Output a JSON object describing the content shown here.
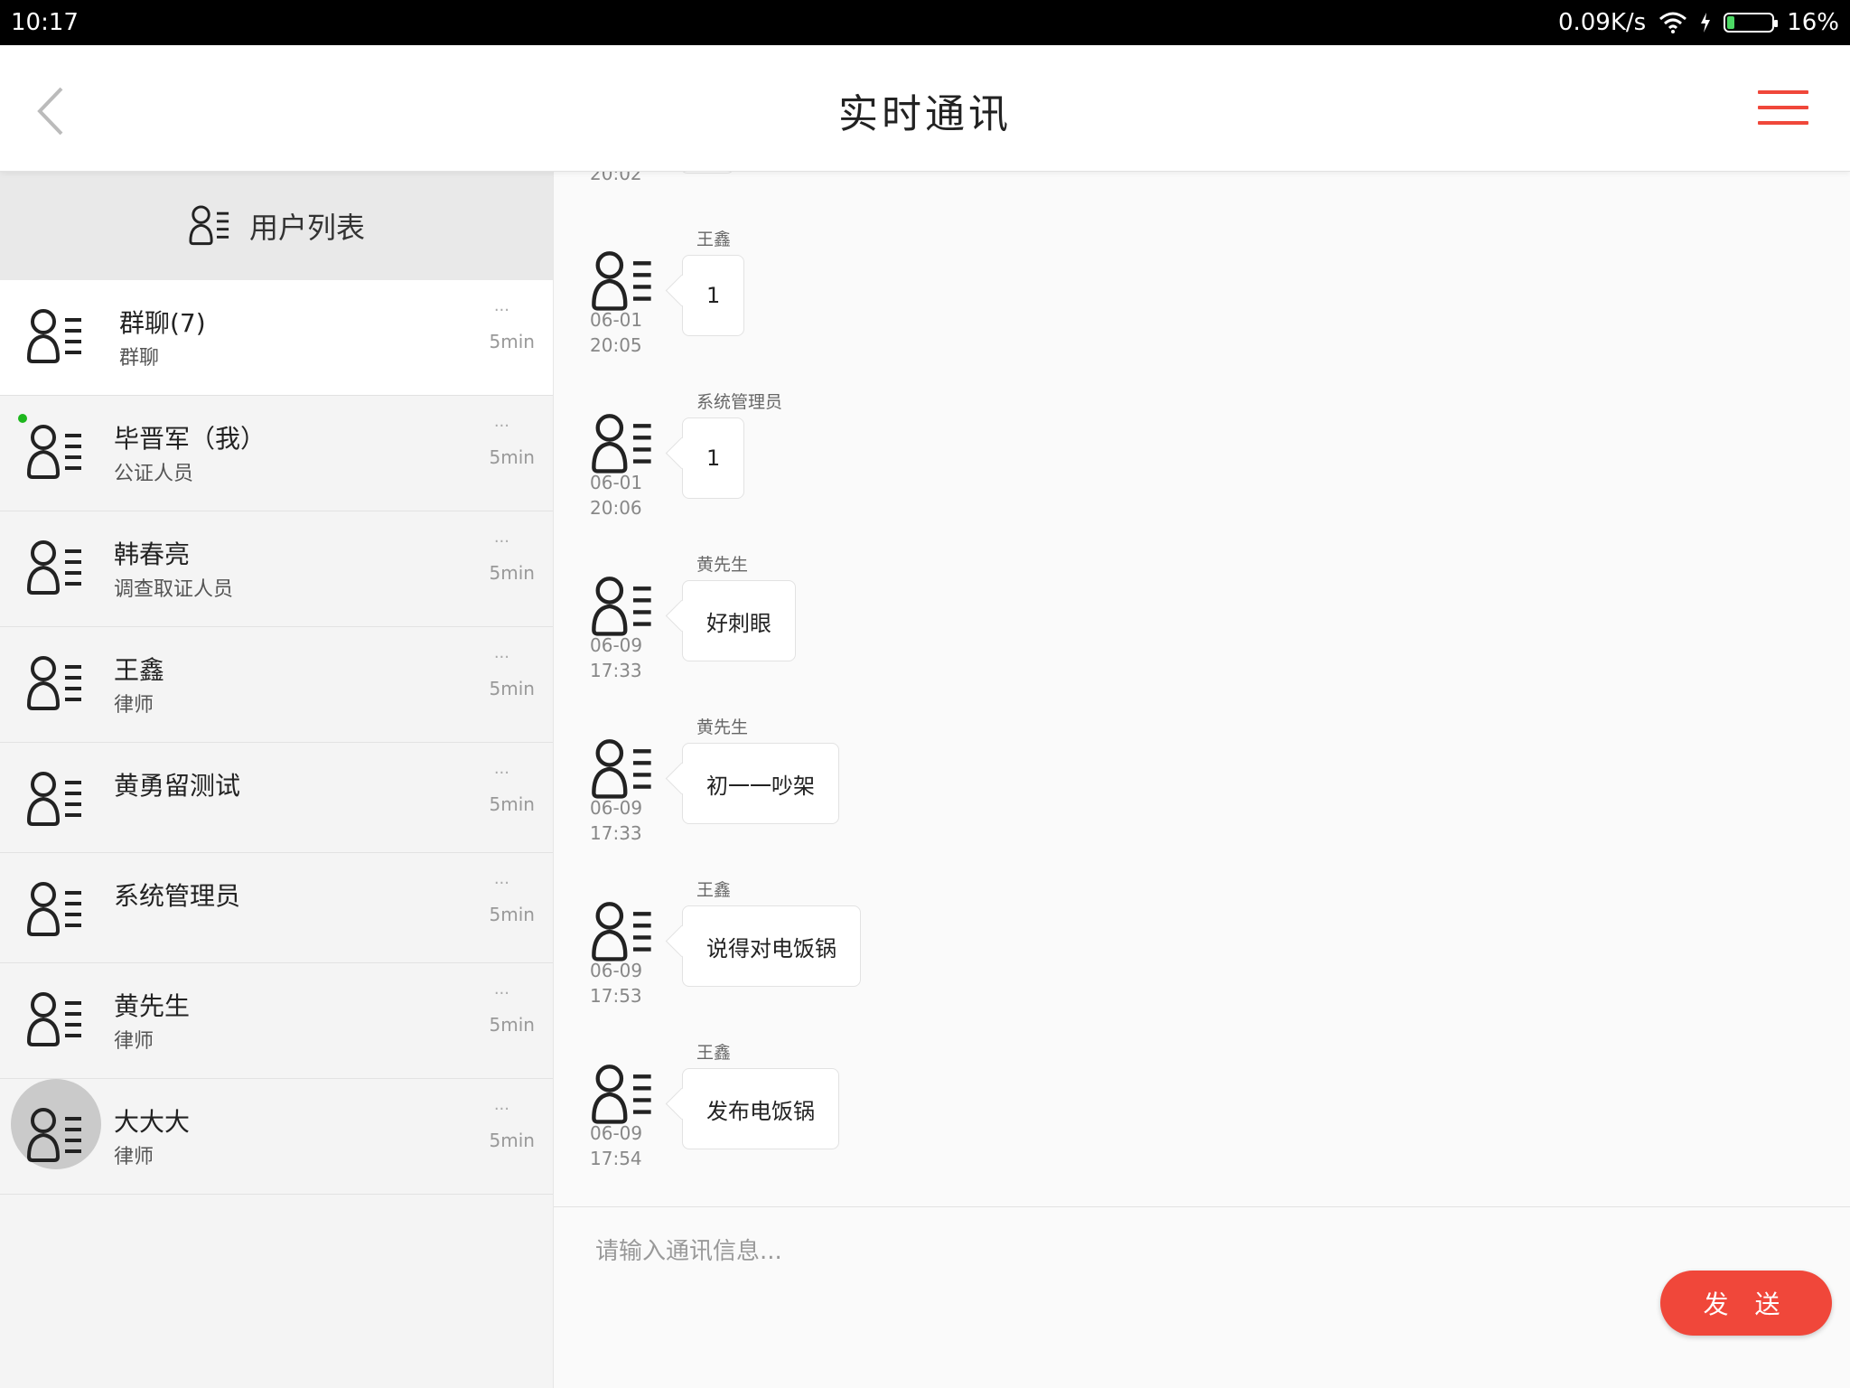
{
  "status_bar": {
    "time": "10:17",
    "net_speed": "0.09K/s",
    "battery_pct": "16%",
    "battery_level": 0.16
  },
  "header": {
    "title": "实时通讯",
    "accent": "#f0473a"
  },
  "sidebar": {
    "heading": "用户列表",
    "users": [
      {
        "name": "群聊(7)",
        "role": "群聊",
        "dots": "...",
        "ago": "5min",
        "active": true
      },
      {
        "name": "毕晋军（我）",
        "role": "公证人员",
        "dots": "...",
        "ago": "5min",
        "online": true
      },
      {
        "name": "韩春亮",
        "role": "调查取证人员",
        "dots": "...",
        "ago": "5min"
      },
      {
        "name": "王鑫",
        "role": "律师",
        "dots": "...",
        "ago": "5min"
      },
      {
        "name": "黄勇留测试",
        "role": "",
        "dots": "...",
        "ago": "5min"
      },
      {
        "name": "系统管理员",
        "role": "",
        "dots": "...",
        "ago": "5min"
      },
      {
        "name": "黄先生",
        "role": "律师",
        "dots": "...",
        "ago": "5min"
      },
      {
        "name": "大大大",
        "role": "律师",
        "dots": "...",
        "ago": "5min"
      }
    ]
  },
  "chat": {
    "top_fragment_time": "20:02",
    "messages": [
      {
        "sender": "王鑫",
        "text": "1",
        "date": "06-01",
        "time": "20:05"
      },
      {
        "sender": "系统管理员",
        "text": "1",
        "date": "06-01",
        "time": "20:06"
      },
      {
        "sender": "黄先生",
        "text": "好刺眼",
        "date": "06-09",
        "time": "17:33"
      },
      {
        "sender": "黄先生",
        "text": "初一一吵架",
        "date": "06-09",
        "time": "17:33"
      },
      {
        "sender": "王鑫",
        "text": "说得对电饭锅",
        "date": "06-09",
        "time": "17:53"
      },
      {
        "sender": "王鑫",
        "text": "发布电饭锅",
        "date": "06-09",
        "time": "17:54"
      }
    ]
  },
  "composer": {
    "placeholder": "请输入通讯信息...",
    "send_label": "发 送"
  }
}
